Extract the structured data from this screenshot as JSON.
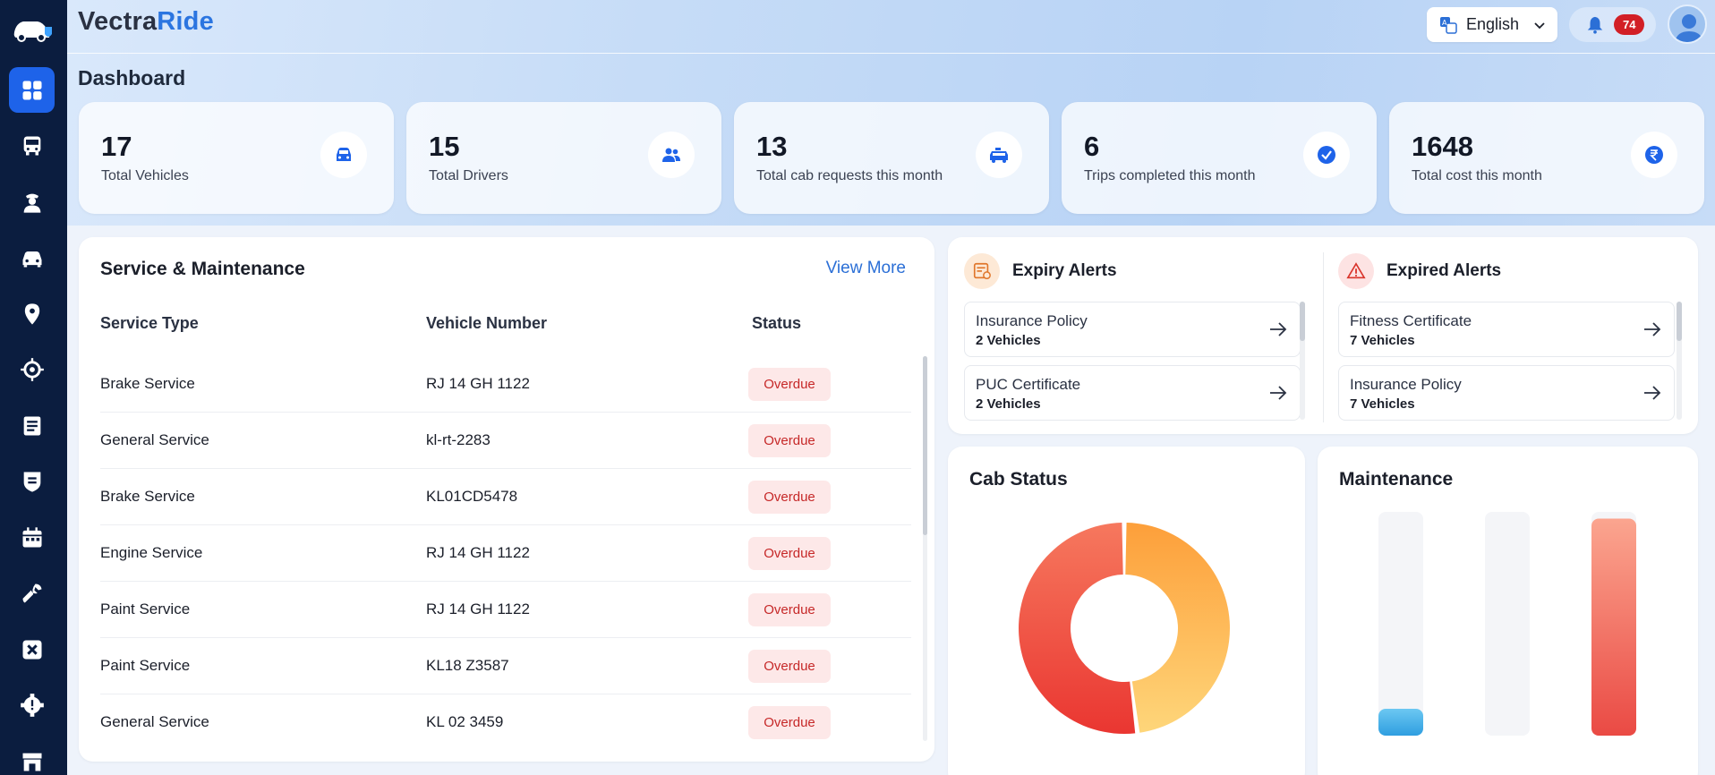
{
  "app": {
    "brand_part1": "Vectra",
    "brand_part2": "Ride"
  },
  "header": {
    "language": "English",
    "notification_count": "74"
  },
  "page": {
    "title": "Dashboard"
  },
  "stats": [
    {
      "value": "17",
      "label": "Total Vehicles",
      "icon": "car-front-icon"
    },
    {
      "value": "15",
      "label": "Total Drivers",
      "icon": "users-icon"
    },
    {
      "value": "13",
      "label": "Total cab requests this month",
      "icon": "cab-request-icon"
    },
    {
      "value": "6",
      "label": "Trips completed this month",
      "icon": "check-circle-icon"
    },
    {
      "value": "1648",
      "label": "Total cost this month",
      "icon": "rupee-icon"
    }
  ],
  "service": {
    "title": "Service & Maintenance",
    "view_more": "View More",
    "columns": [
      "Service Type",
      "Vehicle Number",
      "Status"
    ],
    "rows": [
      {
        "type": "Brake Service",
        "vehicle": "RJ 14 GH 1122",
        "status": "Overdue"
      },
      {
        "type": "General Service",
        "vehicle": "kl-rt-2283",
        "status": "Overdue"
      },
      {
        "type": "Brake Service",
        "vehicle": "KL01CD5478",
        "status": "Overdue"
      },
      {
        "type": "Engine Service",
        "vehicle": "RJ 14 GH 1122",
        "status": "Overdue"
      },
      {
        "type": "Paint Service",
        "vehicle": "RJ 14 GH 1122",
        "status": "Overdue"
      },
      {
        "type": "Paint Service",
        "vehicle": "KL18 Z3587",
        "status": "Overdue"
      },
      {
        "type": "General Service",
        "vehicle": "KL 02 3459",
        "status": "Overdue"
      }
    ]
  },
  "expiry_alerts": {
    "title": "Expiry Alerts",
    "items": [
      {
        "title": "Insurance Policy",
        "count": "2 Vehicles"
      },
      {
        "title": "PUC Certificate",
        "count": "2 Vehicles"
      }
    ]
  },
  "expired_alerts": {
    "title": "Expired Alerts",
    "items": [
      {
        "title": "Fitness Certificate",
        "count": "7 Vehicles"
      },
      {
        "title": "Insurance Policy",
        "count": "7 Vehicles"
      }
    ]
  },
  "cab_status": {
    "title": "Cab Status"
  },
  "maintenance": {
    "title": "Maintenance"
  },
  "chart_data": [
    {
      "type": "pie",
      "title": "Cab Status",
      "values": [
        0.48,
        0.52
      ],
      "colors": [
        "#fdb84d",
        "#ee4b3e"
      ]
    },
    {
      "type": "bar",
      "title": "Maintenance",
      "values": [
        0.12,
        0,
        0.97
      ],
      "colors": [
        "#4fb7ec",
        "#e8e9ed",
        "#ef5b4f"
      ]
    }
  ],
  "colors": {
    "primary": "#1e63e9",
    "sidebar": "#0b1d3f",
    "overdue": "#c62828",
    "overdue_bg": "#fde8e8",
    "link": "#2b6fd6"
  }
}
